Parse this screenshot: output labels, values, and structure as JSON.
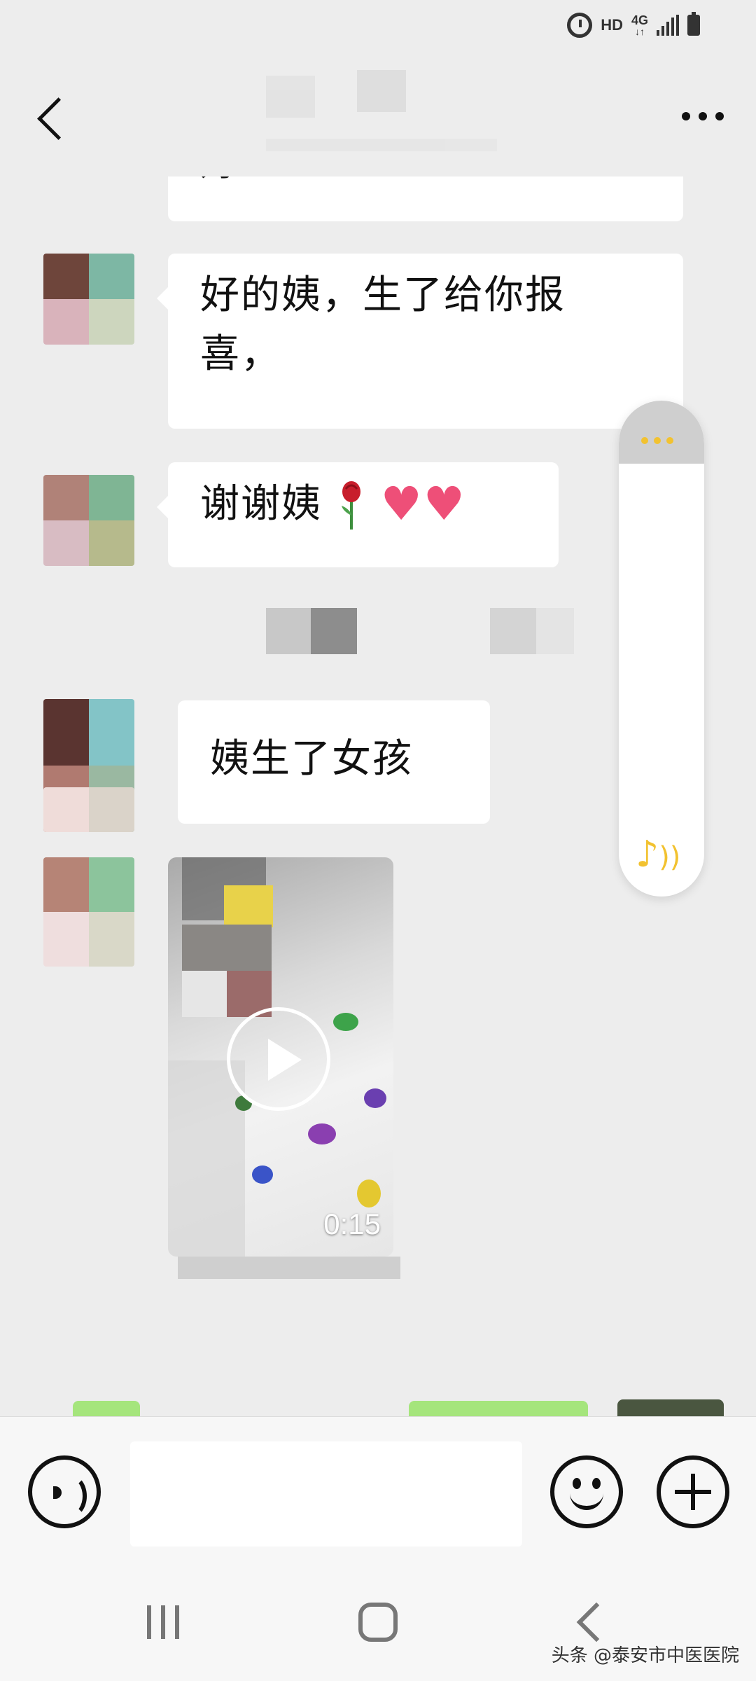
{
  "status_bar": {
    "network_hd": "HD",
    "network_4g": "4G",
    "network_arrows": "↓↑"
  },
  "header": {
    "back_icon": "chevron-left-icon",
    "more_icon": "more-dots-icon"
  },
  "messages": [
    {
      "type": "text",
      "sender": "other",
      "text": "好",
      "partial": true
    },
    {
      "type": "text",
      "sender": "other",
      "lines": [
        "好的姨，生了给你报",
        "喜，"
      ]
    },
    {
      "type": "text",
      "sender": "other",
      "text": "谢谢姨",
      "emojis": [
        "rose",
        "heart",
        "heart"
      ]
    },
    {
      "type": "text",
      "sender": "other",
      "text": "姨生了女孩"
    },
    {
      "type": "video",
      "sender": "other",
      "duration": "0:15"
    }
  ],
  "colors": {
    "background": "#ededed",
    "bubble": "#ffffff",
    "accent_yellow": "#f2c230",
    "heart": "#ee4f78",
    "green_bubble": "#9ce36f"
  },
  "input_bar": {
    "voice_icon": "voice-icon",
    "emoji_icon": "emoji-smile-icon",
    "plus_icon": "plus-icon"
  },
  "nav_bar": {
    "recents_icon": "recents-icon",
    "home_icon": "home-icon",
    "back_icon": "back-icon"
  },
  "watermark": "头条 @泰安市中医医院"
}
